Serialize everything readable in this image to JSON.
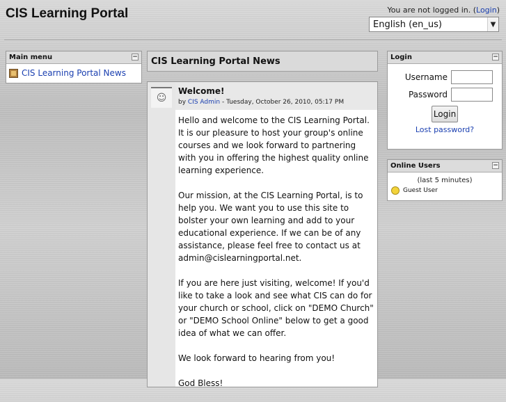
{
  "header": {
    "site_title": "CIS Learning Portal",
    "login_info_prefix": "You are not logged in. (",
    "login_link": "Login",
    "login_info_suffix": ")",
    "language_selected": "English (en_us)"
  },
  "main_menu": {
    "title": "Main menu",
    "items": [
      {
        "label": "CIS Learning Portal News"
      }
    ]
  },
  "news": {
    "heading": "CIS Learning Portal News",
    "post": {
      "subject": "Welcome!",
      "by_prefix": "by ",
      "author": "CIS Admin",
      "date": " - Tuesday, October 26, 2010, 05:17 PM",
      "paragraphs": [
        "Hello and welcome to the CIS Learning Portal. It is our pleasure to host your group's online courses and we look forward to partnering with you in offering the highest quality online learning experience.",
        "Our mission, at the CIS Learning Portal, is to help you. We want you to use this site to bolster your own learning and add to your educational experience. If we can be of any assistance, please feel free to contact us at admin@cislearningportal.net.",
        "If you are here just visiting, welcome! If you'd like to take a look and see what CIS can do for your church or school, click on \"DEMO Church\" or \"DEMO School Online\" below to get a good idea of what we can offer.",
        "We look forward to hearing from you!",
        "God Bless!"
      ]
    }
  },
  "login_block": {
    "title": "Login",
    "username_label": "Username",
    "password_label": "Password",
    "button_label": "Login",
    "lost_password": "Lost password?"
  },
  "online_users": {
    "title": "Online Users",
    "period": "(last 5 minutes)",
    "users": [
      {
        "name": "Guest User"
      }
    ]
  },
  "icons": {
    "hide": "minus-box-icon",
    "select_arrow": "triangle-down-icon"
  }
}
